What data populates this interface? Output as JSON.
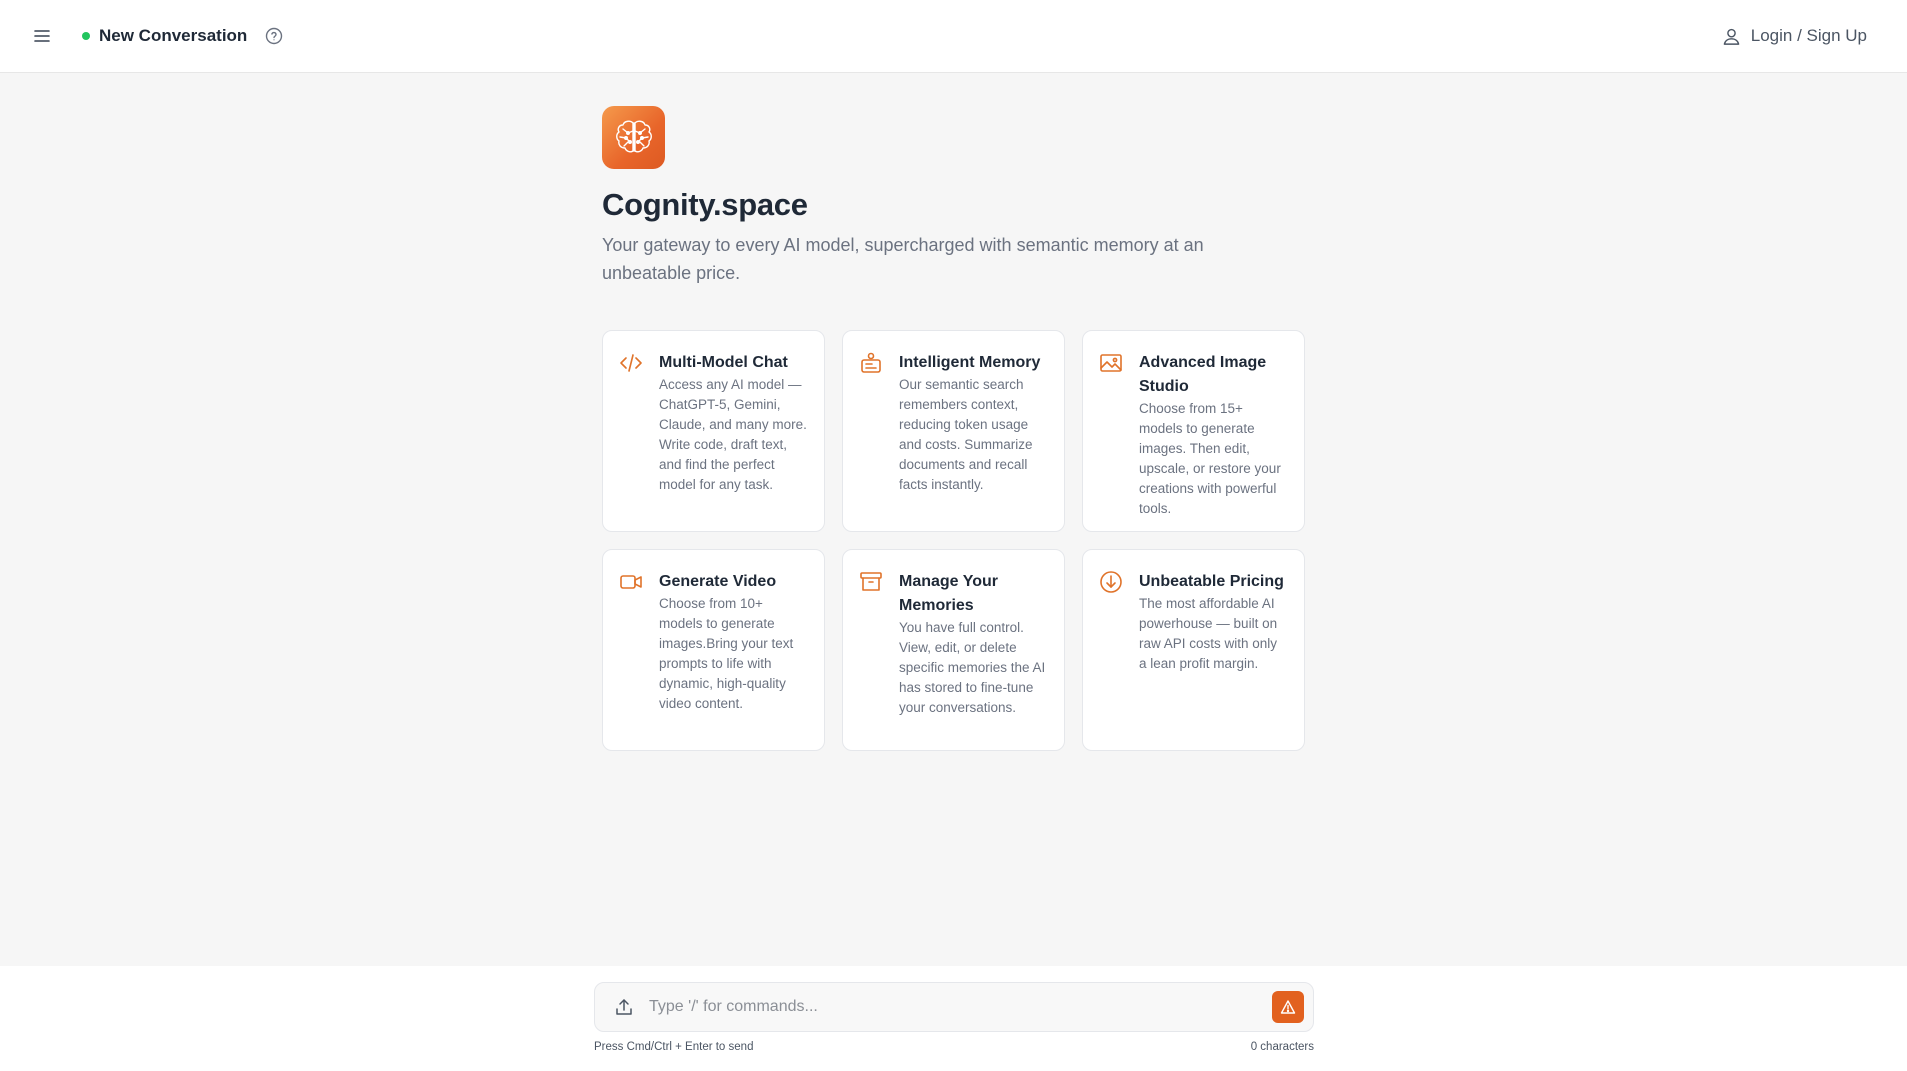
{
  "header": {
    "conversation_title": "New Conversation",
    "status_color": "#22c55e",
    "login_label": "Login / Sign Up",
    "icons": {
      "menu": "hamburger-menu-icon",
      "help": "question-circle-icon",
      "user": "user-icon"
    }
  },
  "hero": {
    "logo_icon": "brain-icon",
    "title": "Cognity.space",
    "tagline": "Your gateway to every AI model, supercharged with semantic memory at an unbeatable price."
  },
  "features": [
    {
      "icon": "code-icon",
      "title": "Multi-Model Chat",
      "description": "Access any AI model — ChatGPT-5, Gemini, Claude, and many more. Write code, draft text, and find the perfect model for any task."
    },
    {
      "icon": "memory-icon",
      "title": "Intelligent Memory",
      "description": "Our semantic search remembers context, reducing token usage and costs. Summarize documents and recall facts instantly."
    },
    {
      "icon": "image-icon",
      "title": "Advanced Image Studio",
      "description": "Choose from 15+ models to generate images. Then edit, upscale, or restore your creations with powerful tools."
    },
    {
      "icon": "video-icon",
      "title": "Generate Video",
      "description": "Choose from 10+ models to generate images.Bring your text prompts to life with dynamic, high-quality video content."
    },
    {
      "icon": "archive-icon",
      "title": "Manage Your Memories",
      "description": "You have full control. View, edit, or delete specific memories the AI has stored to fine-tune your conversations."
    },
    {
      "icon": "download-circle-icon",
      "title": "Unbeatable Pricing",
      "description": "The most affordable AI powerhouse — built on raw API costs with only a lean profit margin."
    }
  ],
  "composer": {
    "placeholder": "Type '/' for commands...",
    "value": "",
    "hint": "Press Cmd/Ctrl + Enter to send",
    "char_count": "0 characters",
    "accent_color": "#e2611f",
    "icons": {
      "upload": "upload-icon",
      "send": "warning-triangle-icon"
    }
  }
}
